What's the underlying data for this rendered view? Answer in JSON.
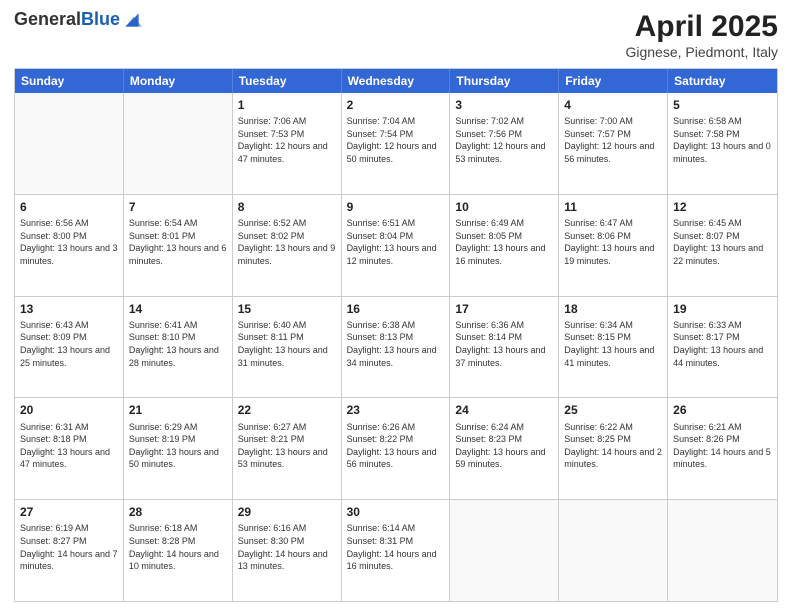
{
  "logo": {
    "general": "General",
    "blue": "Blue"
  },
  "title": "April 2025",
  "location": "Gignese, Piedmont, Italy",
  "header_days": [
    "Sunday",
    "Monday",
    "Tuesday",
    "Wednesday",
    "Thursday",
    "Friday",
    "Saturday"
  ],
  "weeks": [
    [
      {
        "day": "",
        "info": ""
      },
      {
        "day": "",
        "info": ""
      },
      {
        "day": "1",
        "info": "Sunrise: 7:06 AM\nSunset: 7:53 PM\nDaylight: 12 hours and 47 minutes."
      },
      {
        "day": "2",
        "info": "Sunrise: 7:04 AM\nSunset: 7:54 PM\nDaylight: 12 hours and 50 minutes."
      },
      {
        "day": "3",
        "info": "Sunrise: 7:02 AM\nSunset: 7:56 PM\nDaylight: 12 hours and 53 minutes."
      },
      {
        "day": "4",
        "info": "Sunrise: 7:00 AM\nSunset: 7:57 PM\nDaylight: 12 hours and 56 minutes."
      },
      {
        "day": "5",
        "info": "Sunrise: 6:58 AM\nSunset: 7:58 PM\nDaylight: 13 hours and 0 minutes."
      }
    ],
    [
      {
        "day": "6",
        "info": "Sunrise: 6:56 AM\nSunset: 8:00 PM\nDaylight: 13 hours and 3 minutes."
      },
      {
        "day": "7",
        "info": "Sunrise: 6:54 AM\nSunset: 8:01 PM\nDaylight: 13 hours and 6 minutes."
      },
      {
        "day": "8",
        "info": "Sunrise: 6:52 AM\nSunset: 8:02 PM\nDaylight: 13 hours and 9 minutes."
      },
      {
        "day": "9",
        "info": "Sunrise: 6:51 AM\nSunset: 8:04 PM\nDaylight: 13 hours and 12 minutes."
      },
      {
        "day": "10",
        "info": "Sunrise: 6:49 AM\nSunset: 8:05 PM\nDaylight: 13 hours and 16 minutes."
      },
      {
        "day": "11",
        "info": "Sunrise: 6:47 AM\nSunset: 8:06 PM\nDaylight: 13 hours and 19 minutes."
      },
      {
        "day": "12",
        "info": "Sunrise: 6:45 AM\nSunset: 8:07 PM\nDaylight: 13 hours and 22 minutes."
      }
    ],
    [
      {
        "day": "13",
        "info": "Sunrise: 6:43 AM\nSunset: 8:09 PM\nDaylight: 13 hours and 25 minutes."
      },
      {
        "day": "14",
        "info": "Sunrise: 6:41 AM\nSunset: 8:10 PM\nDaylight: 13 hours and 28 minutes."
      },
      {
        "day": "15",
        "info": "Sunrise: 6:40 AM\nSunset: 8:11 PM\nDaylight: 13 hours and 31 minutes."
      },
      {
        "day": "16",
        "info": "Sunrise: 6:38 AM\nSunset: 8:13 PM\nDaylight: 13 hours and 34 minutes."
      },
      {
        "day": "17",
        "info": "Sunrise: 6:36 AM\nSunset: 8:14 PM\nDaylight: 13 hours and 37 minutes."
      },
      {
        "day": "18",
        "info": "Sunrise: 6:34 AM\nSunset: 8:15 PM\nDaylight: 13 hours and 41 minutes."
      },
      {
        "day": "19",
        "info": "Sunrise: 6:33 AM\nSunset: 8:17 PM\nDaylight: 13 hours and 44 minutes."
      }
    ],
    [
      {
        "day": "20",
        "info": "Sunrise: 6:31 AM\nSunset: 8:18 PM\nDaylight: 13 hours and 47 minutes."
      },
      {
        "day": "21",
        "info": "Sunrise: 6:29 AM\nSunset: 8:19 PM\nDaylight: 13 hours and 50 minutes."
      },
      {
        "day": "22",
        "info": "Sunrise: 6:27 AM\nSunset: 8:21 PM\nDaylight: 13 hours and 53 minutes."
      },
      {
        "day": "23",
        "info": "Sunrise: 6:26 AM\nSunset: 8:22 PM\nDaylight: 13 hours and 56 minutes."
      },
      {
        "day": "24",
        "info": "Sunrise: 6:24 AM\nSunset: 8:23 PM\nDaylight: 13 hours and 59 minutes."
      },
      {
        "day": "25",
        "info": "Sunrise: 6:22 AM\nSunset: 8:25 PM\nDaylight: 14 hours and 2 minutes."
      },
      {
        "day": "26",
        "info": "Sunrise: 6:21 AM\nSunset: 8:26 PM\nDaylight: 14 hours and 5 minutes."
      }
    ],
    [
      {
        "day": "27",
        "info": "Sunrise: 6:19 AM\nSunset: 8:27 PM\nDaylight: 14 hours and 7 minutes."
      },
      {
        "day": "28",
        "info": "Sunrise: 6:18 AM\nSunset: 8:28 PM\nDaylight: 14 hours and 10 minutes."
      },
      {
        "day": "29",
        "info": "Sunrise: 6:16 AM\nSunset: 8:30 PM\nDaylight: 14 hours and 13 minutes."
      },
      {
        "day": "30",
        "info": "Sunrise: 6:14 AM\nSunset: 8:31 PM\nDaylight: 14 hours and 16 minutes."
      },
      {
        "day": "",
        "info": ""
      },
      {
        "day": "",
        "info": ""
      },
      {
        "day": "",
        "info": ""
      }
    ]
  ]
}
